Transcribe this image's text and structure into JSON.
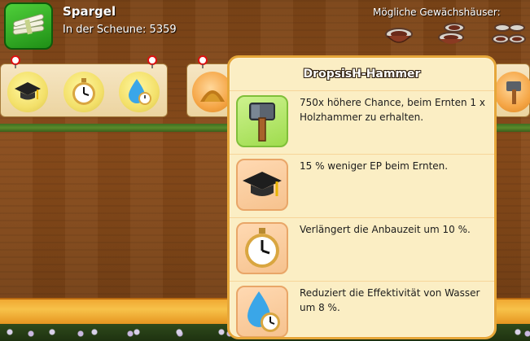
{
  "header": {
    "product_name": "Spargel",
    "barn_label": "In der Scheune: 5359",
    "greenhouses_label": "Mögliche Gewächshäuser:"
  },
  "tooltip": {
    "title": "DropsisH-Hammer",
    "effects": [
      {
        "icon": "wooden-hammer-icon",
        "text": "750x höhere Chance, beim Ernten 1 x Holzhammer zu erhalten."
      },
      {
        "icon": "graduation-cap-icon",
        "text": "15 % weniger EP beim Ernten."
      },
      {
        "icon": "stopwatch-icon",
        "text": "Verlängert die Anbauzeit um 10 %."
      },
      {
        "icon": "water-drop-clock-icon",
        "text": "Reduziert die Effektivität von Wasser um 8 %."
      }
    ]
  },
  "colors": {
    "wood": "#7b4417",
    "tooltip_bg": "#fbeec4",
    "tooltip_border": "#e6a73a",
    "highlight_icon_bg": "#9fdc4e"
  }
}
